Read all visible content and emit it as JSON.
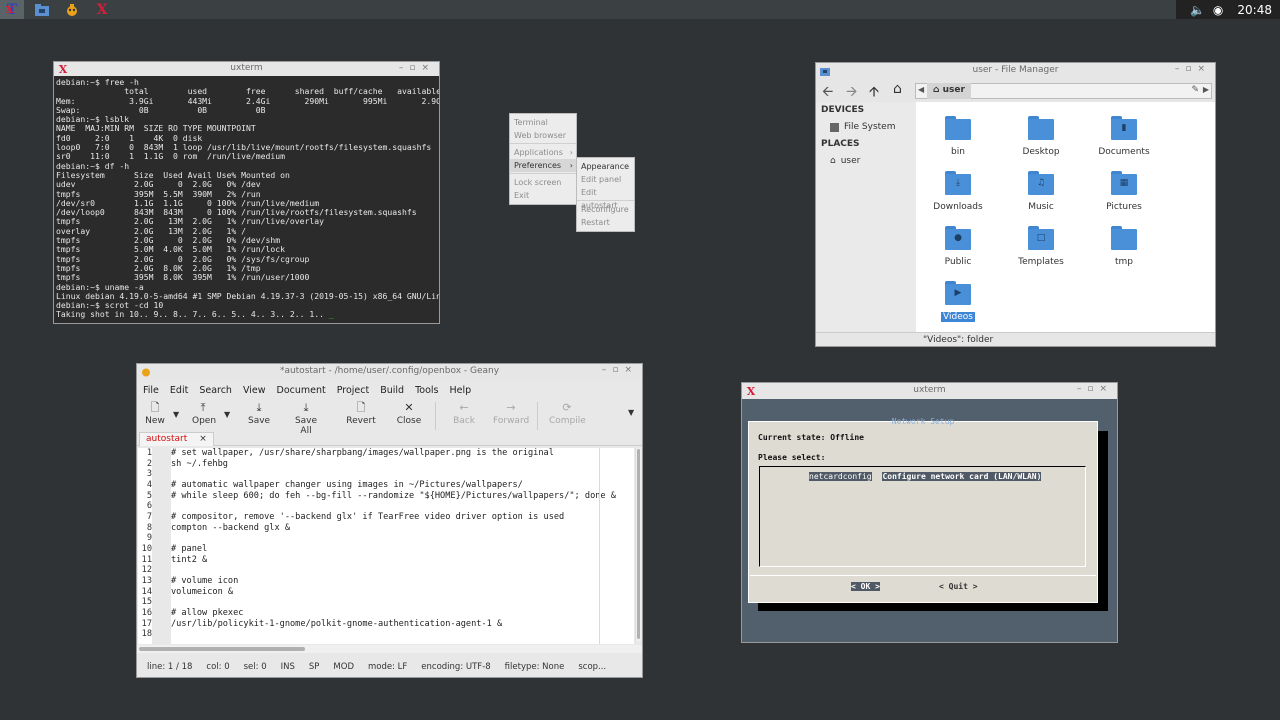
{
  "panel": {
    "time": "20:48"
  },
  "uxterm1": {
    "title": "uxterm",
    "lines": [
      "debian:~$ free -h",
      "              total        used        free      shared  buff/cache   available",
      "Mem:           3.9Gi       443Mi       2.4Gi       290Mi       995Mi       2.9Gi",
      "Swap:            0B          0B          0B",
      "debian:~$ lsblk",
      "NAME  MAJ:MIN RM  SIZE RO TYPE MOUNTPOINT",
      "fd0     2:0    1    4K  0 disk",
      "loop0   7:0    0  843M  1 loop /usr/lib/live/mount/rootfs/filesystem.squashfs",
      "sr0    11:0    1  1.1G  0 rom  /run/live/medium",
      "debian:~$ df -h",
      "Filesystem      Size  Used Avail Use% Mounted on",
      "udev            2.0G     0  2.0G   0% /dev",
      "tmpfs           395M  5.5M  390M   2% /run",
      "/dev/sr0        1.1G  1.1G     0 100% /run/live/medium",
      "/dev/loop0      843M  843M     0 100% /run/live/rootfs/filesystem.squashfs",
      "tmpfs           2.0G   13M  2.0G   1% /run/live/overlay",
      "overlay         2.0G   13M  2.0G   1% /",
      "tmpfs           2.0G     0  2.0G   0% /dev/shm",
      "tmpfs           5.0M  4.0K  5.0M   1% /run/lock",
      "tmpfs           2.0G     0  2.0G   0% /sys/fs/cgroup",
      "tmpfs           2.0G  8.0K  2.0G   1% /tmp",
      "tmpfs           395M  8.0K  395M   1% /run/user/1000",
      "debian:~$ uname -a",
      "Linux debian 4.19.0-5-amd64 #1 SMP Debian 4.19.37-3 (2019-05-15) x86_64 GNU/Linux",
      "debian:~$ scrot -cd 10"
    ],
    "last_line": "Taking shot in 10.. 9.. 8.. 7.. 6.. 5.. 4.. 3.. 2.. 1.. "
  },
  "desktop_menu": {
    "items": [
      "Terminal",
      "Web browser",
      "Applications",
      "Preferences",
      "Lock screen",
      "Exit"
    ],
    "submenu": [
      "Appearance",
      "Edit panel",
      "Edit autostart",
      "Reconfigure",
      "Restart"
    ]
  },
  "file_manager": {
    "title": "user - File Manager",
    "path": "user",
    "devices_heading": "DEVICES",
    "file_system": "File System",
    "places_heading": "PLACES",
    "place_user": "user",
    "folders": [
      "bin",
      "Desktop",
      "Documents",
      "Downloads",
      "Music",
      "Pictures",
      "Public",
      "Templates",
      "tmp",
      "Videos"
    ],
    "status": "\"Videos\": folder"
  },
  "geany": {
    "title": "*autostart - /home/user/.config/openbox - Geany",
    "menu": [
      "File",
      "Edit",
      "Search",
      "View",
      "Document",
      "Project",
      "Build",
      "Tools",
      "Help"
    ],
    "toolbar": [
      "New",
      "Open",
      "Save",
      "Save All",
      "Revert",
      "Close",
      "Back",
      "Forward",
      "Compile"
    ],
    "tab": "autostart",
    "line_numbers": "1\n2\n3\n4\n5\n6\n7\n8\n9\n10\n11\n12\n13\n14\n15\n16\n17\n18",
    "code": "# set wallpaper, /usr/share/sharpbang/images/wallpaper.png is the original\nsh ~/.fehbg\n\n# automatic wallpaper changer using images in ~/Pictures/wallpapers/\n# while sleep 600; do feh --bg-fill --randomize \"${HOME}/Pictures/wallpapers/\"; done &\n\n# compositor, remove '--backend glx' if TearFree video driver option is used\ncompton --backend glx &\n\n# panel\ntint2 &\n\n# volume icon\nvolumeicon &\n\n# allow pkexec\n/usr/lib/policykit-1-gnome/polkit-gnome-authentication-agent-1 &\n",
    "status": [
      "line: 1 / 18",
      "col: 0",
      "sel: 0",
      "INS",
      "SP",
      "MOD",
      "mode: LF",
      "encoding: UTF-8",
      "filetype: None",
      "scop..."
    ]
  },
  "uxterm2": {
    "title": "uxterm",
    "dialog_title": "Network Setup",
    "state": "Current state: Offline",
    "prompt": "Please select:",
    "option_key": "netcardconfig",
    "option_desc": "Configure network card (LAN/WLAN)",
    "ok": "<  OK  >",
    "quit": "< Quit >"
  }
}
